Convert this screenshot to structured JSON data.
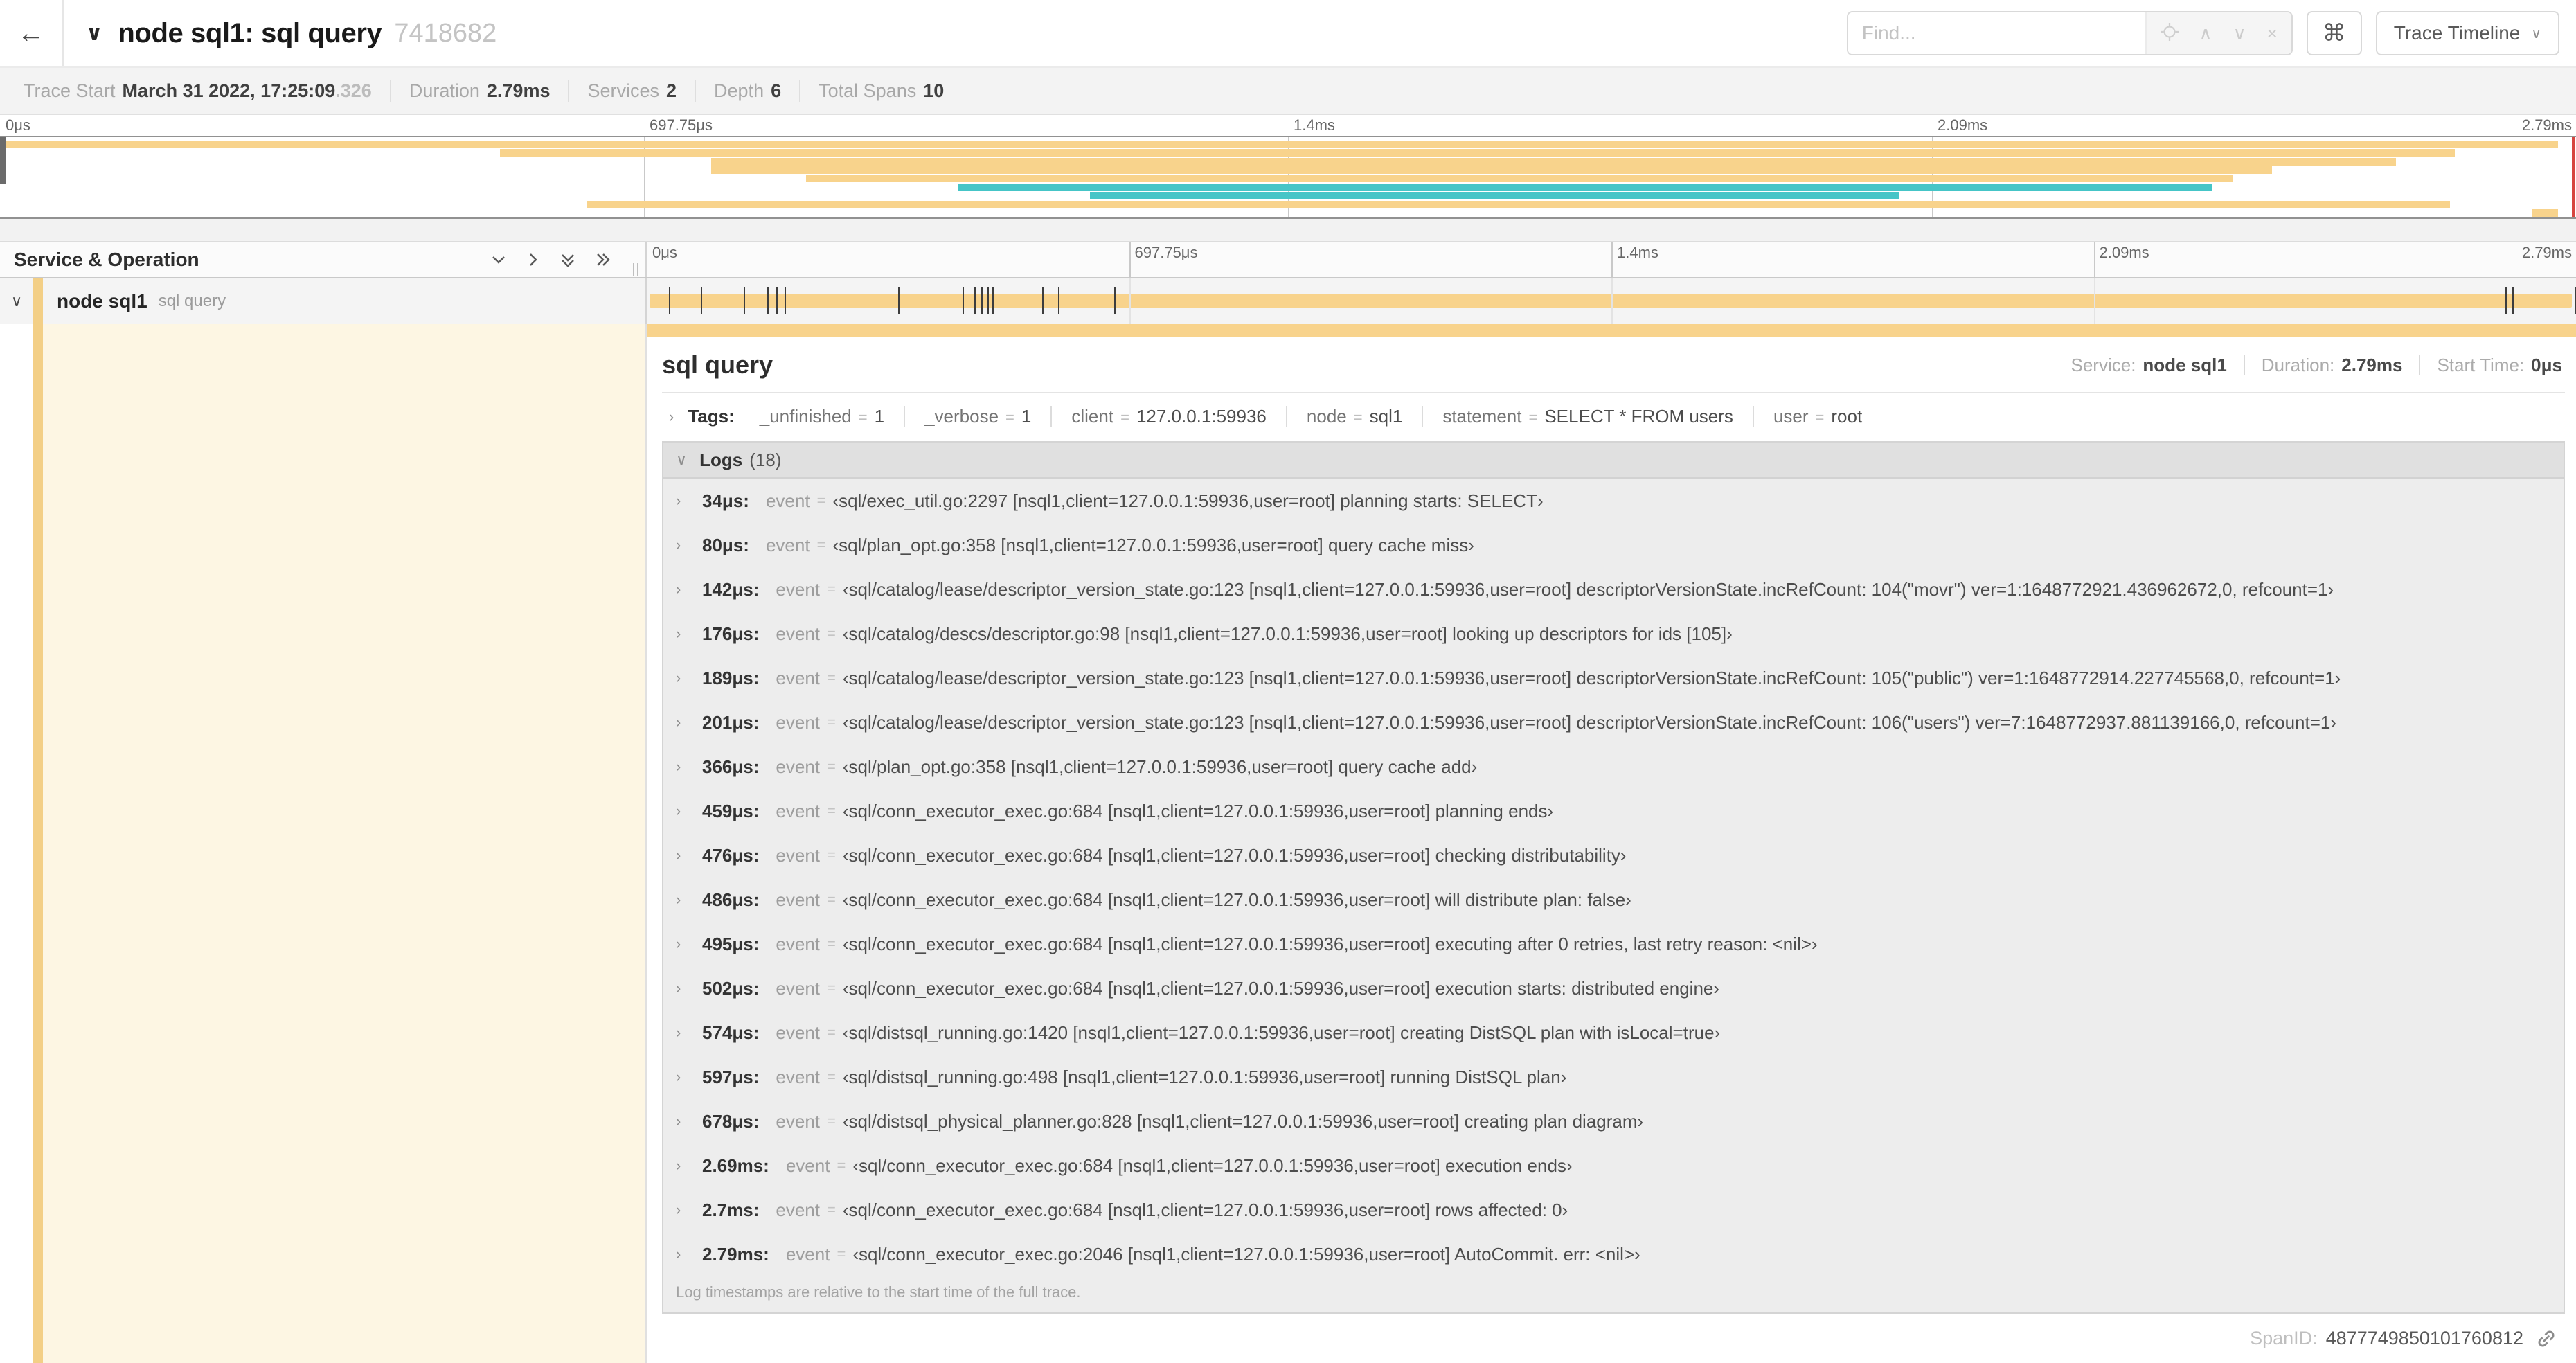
{
  "icons": {
    "back": "←",
    "chevron_down": "∨",
    "chevron_right": "›",
    "caret_up": "∧",
    "caret_down": "∨",
    "close": "×",
    "command": "⌘"
  },
  "header": {
    "title": "node sql1: sql query",
    "trace_id": "7418682",
    "find_placeholder": "Find...",
    "view_selector_label": "Trace Timeline"
  },
  "summary": {
    "items": [
      {
        "label": "Trace Start",
        "value": "March 31 2022, 17:25:09",
        "suffix": ".326"
      },
      {
        "label": "Duration",
        "value": "2.79ms"
      },
      {
        "label": "Services",
        "value": "2"
      },
      {
        "label": "Depth",
        "value": "6"
      },
      {
        "label": "Total Spans",
        "value": "10"
      }
    ]
  },
  "minimap": {
    "spans": [
      {
        "start": 0.0,
        "end": 0.993,
        "color": "#f8d38c"
      },
      {
        "start": 0.194,
        "end": 0.953,
        "color": "#f8d38c"
      },
      {
        "start": 0.276,
        "end": 0.93,
        "color": "#f8d38c"
      },
      {
        "start": 0.276,
        "end": 0.882,
        "color": "#f8d38c"
      },
      {
        "start": 0.313,
        "end": 0.867,
        "color": "#f8d38c"
      },
      {
        "start": 0.372,
        "end": 0.859,
        "color": "#45c5c7"
      },
      {
        "start": 0.423,
        "end": 0.737,
        "color": "#45c5c7"
      },
      {
        "start": 0.228,
        "end": 0.951,
        "color": "#f8d38c"
      },
      {
        "start": 0.983,
        "end": 0.993,
        "color": "#f8d38c"
      }
    ],
    "accent_color": "#f3cf86",
    "span_color": "#f8d38c",
    "teal_color": "#45c5c7"
  },
  "timeline": {
    "left_header": "Service & Operation",
    "ruler_ticks": [
      "0μs",
      "697.75μs",
      "1.4ms",
      "2.09ms",
      "2.79ms"
    ],
    "duration_us": 2790,
    "row": {
      "service": "node sql1",
      "operation": "sql query"
    }
  },
  "detail": {
    "title": "sql query",
    "meta": {
      "service_label": "Service:",
      "service": "node sql1",
      "duration_label": "Duration:",
      "duration": "2.79ms",
      "start_label": "Start Time:",
      "start": "0μs"
    },
    "eq": "=",
    "tags_label": "Tags:",
    "tags": [
      {
        "key": "_unfinished",
        "value": "1"
      },
      {
        "key": "_verbose",
        "value": "1"
      },
      {
        "key": "client",
        "value": "127.0.0.1:59936"
      },
      {
        "key": "node",
        "value": "sql1"
      },
      {
        "key": "statement",
        "value": "SELECT * FROM users"
      },
      {
        "key": "user",
        "value": "root"
      }
    ],
    "logs_label": "Logs",
    "logs_count": "(18)",
    "log_event_key": "event",
    "logs": [
      {
        "time": "34μs:",
        "us": 34,
        "value": "‹sql/exec_util.go:2297 [nsql1,client=127.0.0.1:59936,user=root] planning starts: SELECT›"
      },
      {
        "time": "80μs:",
        "us": 80,
        "value": "‹sql/plan_opt.go:358 [nsql1,client=127.0.0.1:59936,user=root] query cache miss›"
      },
      {
        "time": "142μs:",
        "us": 142,
        "value": "‹sql/catalog/lease/descriptor_version_state.go:123 [nsql1,client=127.0.0.1:59936,user=root] descriptorVersionState.incRefCount: 104(\"movr\") ver=1:1648772921.436962672,0, refcount=1›"
      },
      {
        "time": "176μs:",
        "us": 176,
        "value": "‹sql/catalog/descs/descriptor.go:98 [nsql1,client=127.0.0.1:59936,user=root] looking up descriptors for ids [105]›"
      },
      {
        "time": "189μs:",
        "us": 189,
        "value": "‹sql/catalog/lease/descriptor_version_state.go:123 [nsql1,client=127.0.0.1:59936,user=root] descriptorVersionState.incRefCount: 105(\"public\") ver=1:1648772914.227745568,0, refcount=1›"
      },
      {
        "time": "201μs:",
        "us": 201,
        "value": "‹sql/catalog/lease/descriptor_version_state.go:123 [nsql1,client=127.0.0.1:59936,user=root] descriptorVersionState.incRefCount: 106(\"users\") ver=7:1648772937.881139166,0, refcount=1›"
      },
      {
        "time": "366μs:",
        "us": 366,
        "value": "‹sql/plan_opt.go:358 [nsql1,client=127.0.0.1:59936,user=root] query cache add›"
      },
      {
        "time": "459μs:",
        "us": 459,
        "value": "‹sql/conn_executor_exec.go:684 [nsql1,client=127.0.0.1:59936,user=root] planning ends›"
      },
      {
        "time": "476μs:",
        "us": 476,
        "value": "‹sql/conn_executor_exec.go:684 [nsql1,client=127.0.0.1:59936,user=root] checking distributability›"
      },
      {
        "time": "486μs:",
        "us": 486,
        "value": "‹sql/conn_executor_exec.go:684 [nsql1,client=127.0.0.1:59936,user=root] will distribute plan: false›"
      },
      {
        "time": "495μs:",
        "us": 495,
        "value": "‹sql/conn_executor_exec.go:684 [nsql1,client=127.0.0.1:59936,user=root] executing after 0 retries, last retry reason: <nil>›"
      },
      {
        "time": "502μs:",
        "us": 502,
        "value": "‹sql/conn_executor_exec.go:684 [nsql1,client=127.0.0.1:59936,user=root] execution starts: distributed engine›"
      },
      {
        "time": "574μs:",
        "us": 574,
        "value": "‹sql/distsql_running.go:1420 [nsql1,client=127.0.0.1:59936,user=root] creating DistSQL plan with isLocal=true›"
      },
      {
        "time": "597μs:",
        "us": 597,
        "value": "‹sql/distsql_running.go:498 [nsql1,client=127.0.0.1:59936,user=root] running DistSQL plan›"
      },
      {
        "time": "678μs:",
        "us": 678,
        "value": "‹sql/distsql_physical_planner.go:828 [nsql1,client=127.0.0.1:59936,user=root] creating plan diagram›"
      },
      {
        "time": "2.69ms:",
        "us": 2690,
        "value": "‹sql/conn_executor_exec.go:684 [nsql1,client=127.0.0.1:59936,user=root] execution ends›"
      },
      {
        "time": "2.7ms:",
        "us": 2700,
        "value": "‹sql/conn_executor_exec.go:684 [nsql1,client=127.0.0.1:59936,user=root] rows affected: 0›"
      },
      {
        "time": "2.79ms:",
        "us": 2790,
        "value": "‹sql/conn_executor_exec.go:2046 [nsql1,client=127.0.0.1:59936,user=root] AutoCommit. err: <nil>›"
      }
    ],
    "logs_footer": "Log timestamps are relative to the start time of the full trace.",
    "span_id_label": "SpanID:",
    "span_id": "4877749850101760812"
  }
}
